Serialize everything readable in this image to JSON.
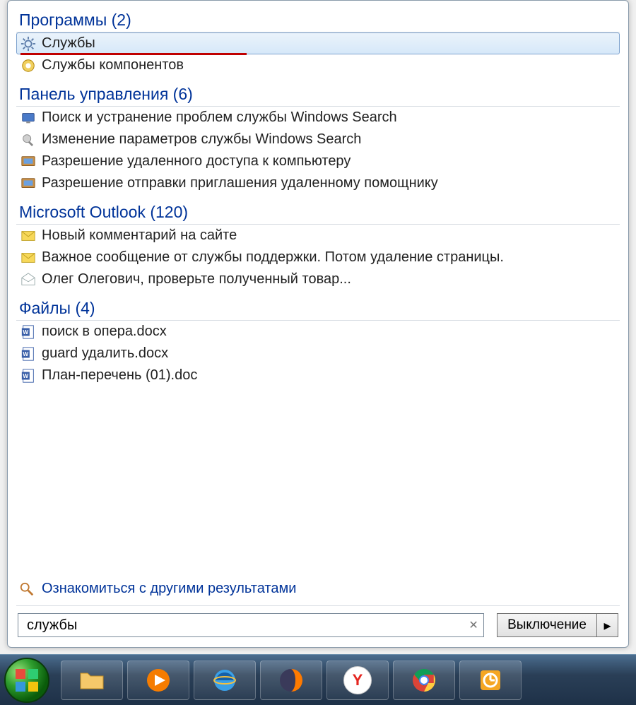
{
  "categories": {
    "programs": {
      "title": "Программы (2)"
    },
    "control_panel": {
      "title": "Панель управления (6)"
    },
    "outlook": {
      "title": "Microsoft Outlook (120)"
    },
    "files": {
      "title": "Файлы (4)"
    }
  },
  "programs": {
    "services": "Службы",
    "component_services": "Службы компонентов"
  },
  "control_panel": {
    "item1": "Поиск и устранение проблем службы Windows Search",
    "item2": "Изменение параметров службы Windows Search",
    "item3": "Разрешение удаленного доступа к компьютеру",
    "item4": "Разрешение отправки приглашения удаленному помощнику"
  },
  "outlook": {
    "item1": "Новый комментарий на сайте",
    "item2": "Важное сообщение от службы поддержки. Потом удаление страницы.",
    "item3": "Олег Олегович, проверьте полученный товар..."
  },
  "files": {
    "item1": "поиск в опера.docx",
    "item2": "guard удалить.docx",
    "item3": "План-перечень (01).doc"
  },
  "more_results": "Ознакомиться с другими результатами",
  "search": {
    "value": "службы"
  },
  "shutdown": {
    "label": "Выключение"
  }
}
